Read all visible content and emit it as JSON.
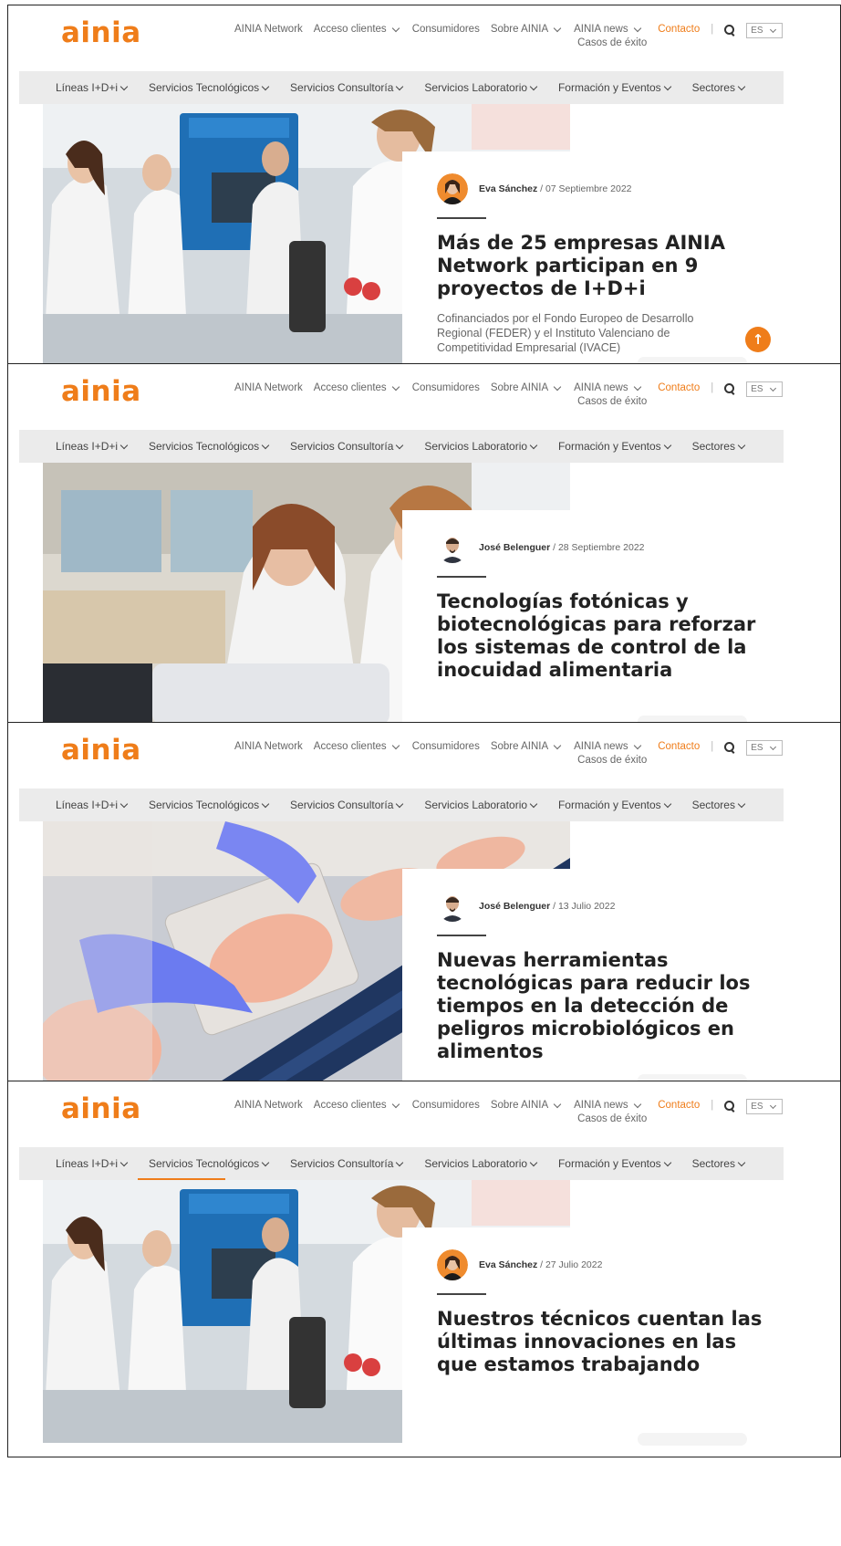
{
  "header": {
    "logo": "ainia",
    "nav": {
      "network": "AINIA Network",
      "acceso": "Acceso clientes",
      "consumidores": "Consumidores",
      "sobre": "Sobre AINIA",
      "news": "AINIA news",
      "casos": "Casos de éxito",
      "contacto": "Contacto",
      "lang": "ES"
    },
    "accent": "#ef7d1a"
  },
  "menu": [
    "Líneas I+D+i",
    "Servicios Tecnológicos",
    "Servicios Consultoría",
    "Servicios Laboratorio",
    "Formación y Eventos",
    "Sectores"
  ],
  "slides": [
    {
      "author": "Eva Sánchez",
      "date": "/ 07 Septiembre 2022",
      "headline": "Más de 25 empresas AINIA Network participan en 9 proyectos de I+D+i",
      "description": "Cofinanciados por el Fondo Europeo de Desarrollo Regional (FEDER) y el Instituto Valenciano de Competitividad Empresarial (IVACE)",
      "image": "lab-team-polardry"
    },
    {
      "author": "José Belenguer",
      "date": "/ 28 Septiembre 2022",
      "headline": "Tecnologías fotónicas y biotecnológicas para reforzar los sistemas de control de la inocuidad alimentaria",
      "description": "",
      "image": "lab-researchers"
    },
    {
      "author": "José Belenguer",
      "date": "/ 13 Julio 2022",
      "headline": "Nuevas herramientas tecnológicas para reducir los tiempos en la detección de peligros microbiológicos en alimentos",
      "description": "",
      "image": "chicken-packaging"
    },
    {
      "author": "Eva Sánchez",
      "date": "/ 27 Julio 2022",
      "headline": "Nuestros técnicos cuentan las últimas innovaciones en las que estamos trabajando",
      "description": "",
      "image": "lab-team-polardry"
    }
  ],
  "scroll_top_icon": "arrow-up-icon"
}
